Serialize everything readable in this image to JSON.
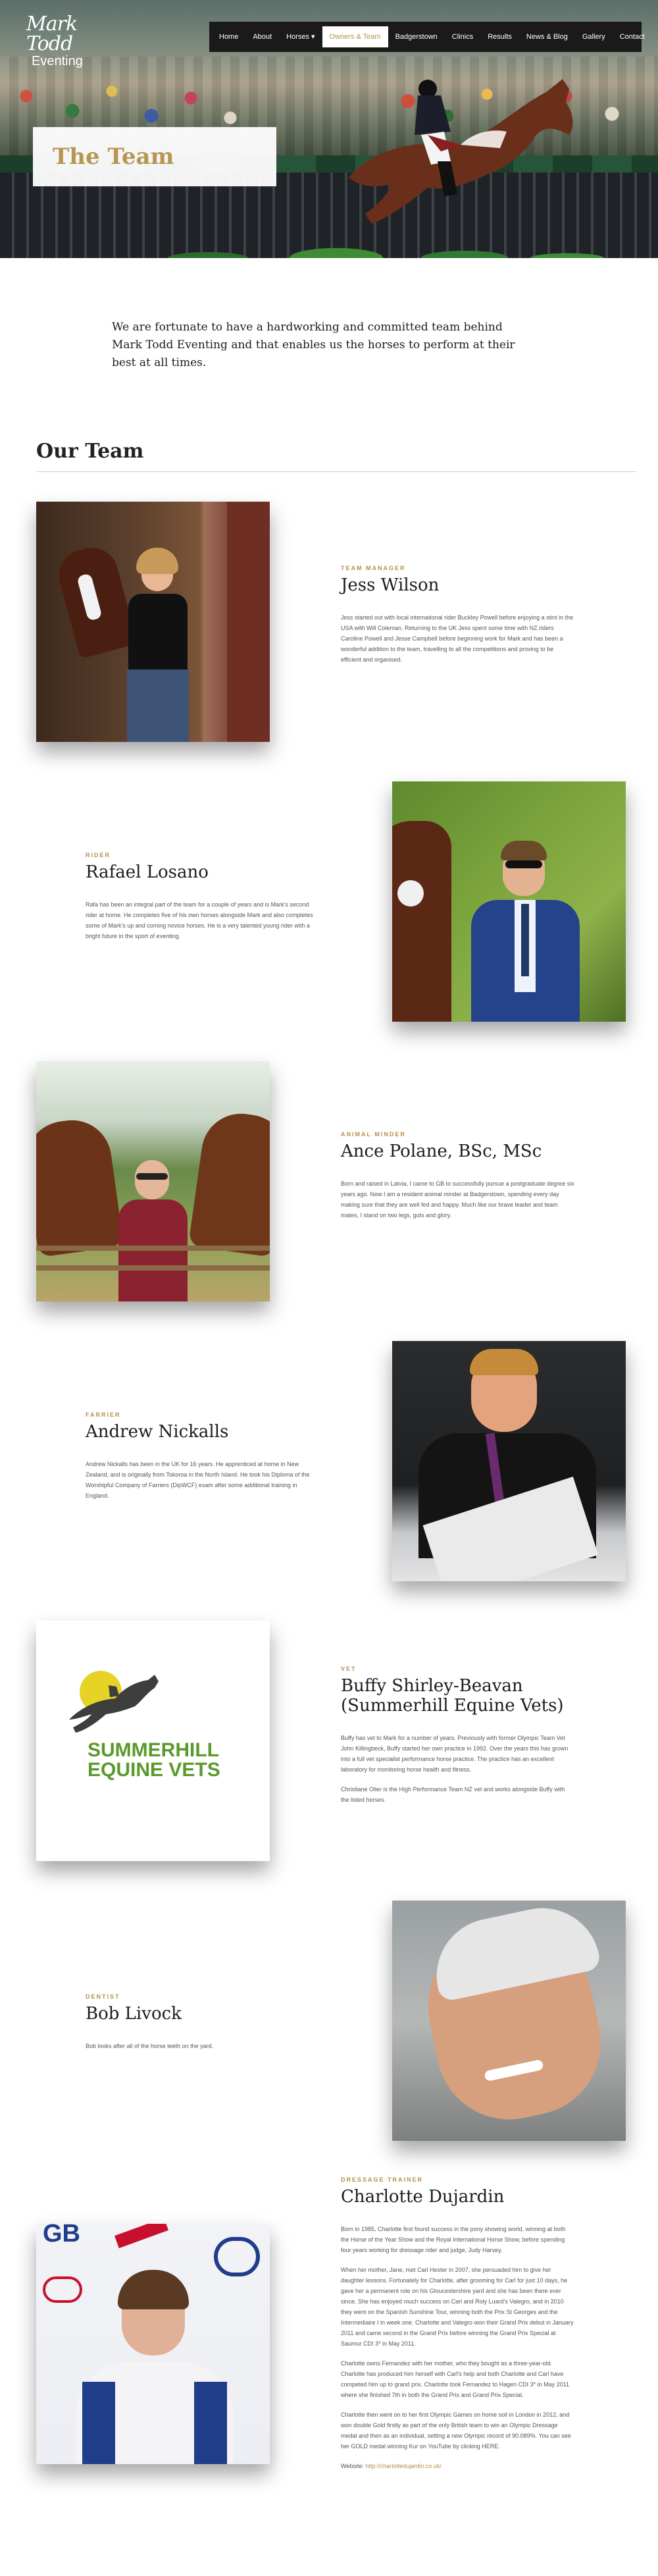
{
  "site": {
    "logo_script": "Mark Todd",
    "logo_sub": "Eventing"
  },
  "nav": {
    "items": [
      {
        "label": "Home"
      },
      {
        "label": "About"
      },
      {
        "label": "Horses ▾"
      },
      {
        "label": "Owners & Team"
      },
      {
        "label": "Badgerstown"
      },
      {
        "label": "Clinics"
      },
      {
        "label": "Results"
      },
      {
        "label": "News & Blog"
      },
      {
        "label": "Gallery"
      },
      {
        "label": "Contact"
      }
    ],
    "active": "Owners & Team"
  },
  "hero": {
    "title": "The Team"
  },
  "intro": "We are fortunate to have a hardworking and committed team behind Mark Todd Eventing and that enables us the horses to perform at their best at all times.",
  "section_title": "Our Team",
  "members": [
    {
      "role": "Team Manager",
      "name": "Jess Wilson",
      "bio": [
        "Jess started out with local international rider Buckley Powell before enjoying a stint in the USA with Will Coleman. Returning to the UK Jess spent some time with NZ riders Caroline Powell and Jesse Campbell before beginning work for Mark and has been a wonderful addition to the team, travelling to all the competitions and proving to be efficient and organised."
      ]
    },
    {
      "role": "Rider",
      "name": "Rafael Losano",
      "bio": [
        "Rafa has been an integral part of the team for a couple of years and is Mark's second rider at home. He completes five of his own horses alongside Mark and also completes some of Mark's up and coming novice horses. He is a very talented young rider with a bright future in the sport of eventing."
      ]
    },
    {
      "role": "Animal Minder",
      "name": "Ance Polane, BSc, MSc",
      "bio": [
        "Born and raised in Latvia, I came to GB to successfully pursue a postgraduate degree six years ago. Now I am a resident animal minder at Badgerstown, spending every day making sure that they are well fed and happy. Much like our brave leader and team mates, I stand on two legs, guts and glory."
      ]
    },
    {
      "role": "Farrier",
      "name": "Andrew Nickalls",
      "bio": [
        "Andrew Nickalls has been in the UK for 16 years. He apprenticed at home in New Zealand, and is originally from Tokoroa in the North Island. He took his Diploma of the Worshipful Company of Farriers (DipWCF) exam after some additional training in England."
      ]
    },
    {
      "role": "Vet",
      "name": "Buffy Shirley-Beavan (Summerhill Equine Vets)",
      "logo_line1": "SUMMERHILL",
      "logo_line2": "EQUINE VETS",
      "bio": [
        "Buffy has vet to Mark for a number of years. Previously with former Olympic Team Vet John Killingbeck, Buffy started her own practice in 1992. Over the years this has grown into a full vet specialist performance horse practice. The practice has an excellent laboratory for monitoring horse health and fitness.",
        "Christiane Olier is the High Performance Team NZ vet and works alongside Buffy with the listed horses."
      ]
    },
    {
      "role": "Dentist",
      "name": "Bob Livock",
      "bio": [
        "Bob looks after all of the horse teeth on the yard."
      ]
    },
    {
      "role": "Dressage Trainer",
      "name": "Charlotte Dujardin",
      "flag_text": "GB",
      "bio": [
        "Born in 1985, Charlotte first found success in the pony showing world, winning at both the Horse of the Year Show and the Royal International Horse Show, before spending four years working for dressage rider and judge, Judy Harvey.",
        "When her mother, Jane, met Carl Hester in 2007, she persuaded him to give her daughter lessons. Fortunately for Charlotte, after grooming for Carl for just 10 days, he gave her a permanent role on his Gloucestershire yard and she has been there ever since. She has enjoyed much success on Carl and Roly Luard's Valegro, and in 2010 they went on the Spanish Sunshine Tour, winning both the Prix St Georges and the Intermediaire I in week one. Charlotte and Valegro won their Grand Prix debut in January 2011 and came second in the Grand Prix before winning the Grand Prix Special at Saumur CDI 3* in May 2011.",
        "Charlotte owns Fernandez with her mother, who they bought as a three-year-old. Charlotte has produced him herself with Carl's help and both Charlotte and Carl have competed him up to grand prix. Charlotte took Fernandez to Hagen CDI 3* in May 2011 where she finished 7th in both the Grand Prix and Grand Prix Special.",
        "Charlotte then went on to her first Olympic Games on home soil in London in 2012, and won double Gold firstly as part of the only British team to win an Olympic Dressage medal and then as an individual, setting a new Olympic record of 90.089%. You can see her GOLD medal winning Kur on YouTube by clicking HERE."
      ],
      "website_label": "Website:",
      "website_link": "http://charlottedujardin.co.uk/"
    }
  ],
  "colors": {
    "accent": "#b58f4b",
    "nav_bg": "#1a1a1a",
    "heading": "#1c1c1c"
  }
}
